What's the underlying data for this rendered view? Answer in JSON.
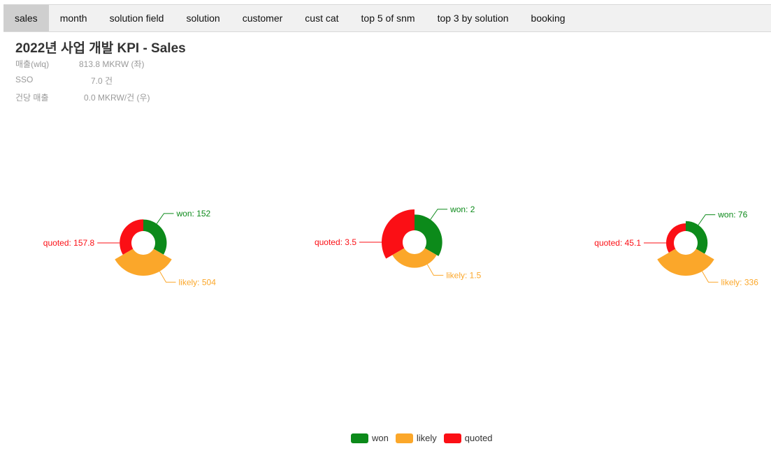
{
  "tabs": [
    {
      "label": "sales",
      "active": true
    },
    {
      "label": "month",
      "active": false
    },
    {
      "label": "solution field",
      "active": false
    },
    {
      "label": "solution",
      "active": false
    },
    {
      "label": "customer",
      "active": false
    },
    {
      "label": "cust cat",
      "active": false
    },
    {
      "label": "top 5 of snm",
      "active": false
    },
    {
      "label": "top 3 by solution",
      "active": false
    },
    {
      "label": "booking",
      "active": false
    }
  ],
  "page_title": "2022년 사업 개발 KPI - Sales",
  "kpis": [
    {
      "label": "매출(wlq)",
      "value": "813.8 MKRW (좌)"
    },
    {
      "label": "SSO",
      "value": "7.0 건"
    },
    {
      "label": "건당 매출",
      "value": "0.0 MKRW/건 (우)"
    }
  ],
  "colors": {
    "won": "#0c8a1a",
    "likely": "#fba72a",
    "quoted": "#fb0f15",
    "active_tab": "#cfcfcf",
    "tabbar": "#f1f1f1"
  },
  "legend": [
    {
      "name": "won",
      "color": "#0c8a1a"
    },
    {
      "name": "likely",
      "color": "#fba72a"
    },
    {
      "name": "quoted",
      "color": "#fb0f15"
    }
  ],
  "chart_data": [
    {
      "type": "pie",
      "variant": "rose-donut",
      "categories": [
        "won",
        "likely",
        "quoted"
      ],
      "values": [
        152,
        504,
        157.8
      ],
      "labels": [
        "won: 152",
        "likely: 504",
        "quoted: 157.8"
      ]
    },
    {
      "type": "pie",
      "variant": "rose-donut",
      "categories": [
        "won",
        "likely",
        "quoted"
      ],
      "values": [
        2,
        1.5,
        3.5
      ],
      "labels": [
        "won: 2",
        "likely: 1.5",
        "quoted: 3.5"
      ]
    },
    {
      "type": "pie",
      "variant": "rose-donut",
      "categories": [
        "won",
        "likely",
        "quoted"
      ],
      "values": [
        76,
        336,
        45.1
      ],
      "labels": [
        "won: 76",
        "likely: 336",
        "quoted: 45.1"
      ]
    }
  ]
}
